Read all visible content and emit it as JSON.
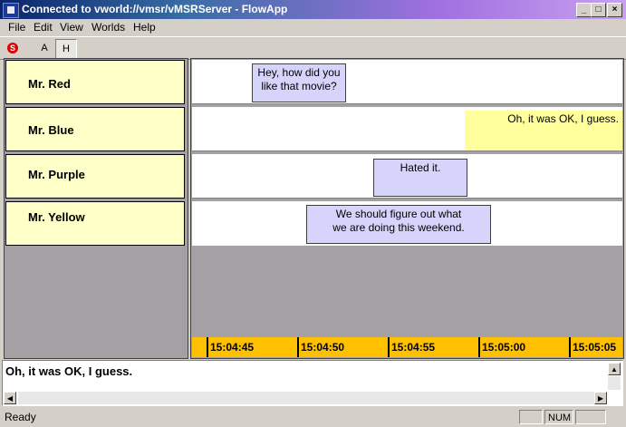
{
  "window": {
    "title": "Connected to vworld://vmsr/vMSRServer - FlowApp",
    "min_glyph": "_",
    "max_glyph": "□",
    "close_glyph": "×"
  },
  "menu": [
    "File",
    "Edit",
    "View",
    "Worlds",
    "Help"
  ],
  "toolbar": {
    "stop_glyph": "S",
    "a_label": "A",
    "h_label": "H"
  },
  "participants": [
    "Mr. Red",
    "Mr. Blue",
    "Mr. Purple",
    "Mr. Yellow"
  ],
  "messages": [
    {
      "speaker": "Mr. Red",
      "line1": "Hey, how did you",
      "line2": "like that movie?"
    },
    {
      "speaker": "Mr. Blue",
      "line1": "Oh, it was OK, I guess.",
      "line2": ""
    },
    {
      "speaker": "Mr. Purple",
      "line1": "Hated it.",
      "line2": ""
    },
    {
      "speaker": "Mr. Yellow",
      "line1": "We should figure out what",
      "line2": "we are doing this weekend."
    }
  ],
  "timeline": [
    "15:04:45",
    "15:04:50",
    "15:04:55",
    "15:05:00",
    "15:05:05"
  ],
  "input": {
    "value": "Oh, it was OK, I guess."
  },
  "status": {
    "text": "Ready",
    "num": "NUM"
  },
  "colors": {
    "name_cell": "#ffffc8",
    "bubble": "#d6d4fa",
    "highlight_bubble": "#ffff9c",
    "timebar": "#ffc000"
  }
}
